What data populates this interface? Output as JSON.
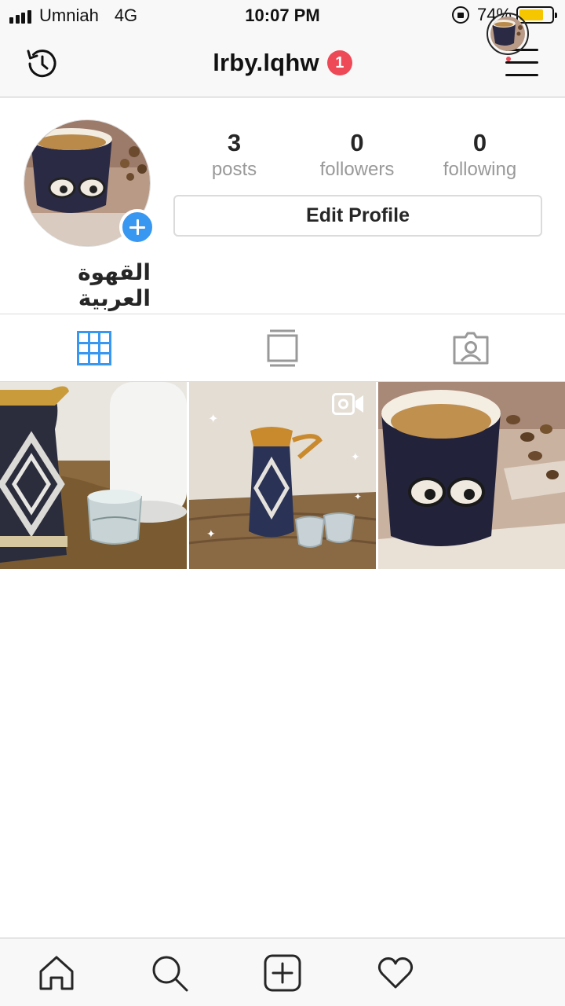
{
  "status_bar": {
    "carrier": "Umniah",
    "network": "4G",
    "time": "10:07 PM",
    "battery_percent": "74%",
    "battery_level": 0.74,
    "battery_color": "#f6c700"
  },
  "header": {
    "username": "lrby.lqhw",
    "notification_count": "1",
    "badge_color": "#ed4956"
  },
  "profile": {
    "display_name": "القهوة العربية",
    "stats": [
      {
        "value": "3",
        "label": "posts"
      },
      {
        "value": "0",
        "label": "followers"
      },
      {
        "value": "0",
        "label": "following"
      }
    ],
    "edit_button_label": "Edit Profile"
  },
  "tabs": [
    {
      "icon": "grid-icon",
      "active": true
    },
    {
      "icon": "feed-icon",
      "active": false
    },
    {
      "icon": "tagged-icon",
      "active": false
    }
  ],
  "posts": [
    {
      "content": "coffee-dallah-and-cups-image",
      "is_video": false
    },
    {
      "content": "dallah-and-cups-on-carpet-image",
      "is_video": true
    },
    {
      "content": "coffee-cup-with-cardamom-image",
      "is_video": false
    }
  ],
  "bottom_nav": [
    {
      "icon": "home-icon"
    },
    {
      "icon": "search-icon"
    },
    {
      "icon": "new-post-icon"
    },
    {
      "icon": "heart-icon"
    },
    {
      "icon": "profile-avatar-icon"
    }
  ],
  "colors": {
    "accent": "#3897f0",
    "text": "#262626",
    "muted": "#999999",
    "border": "#dbdbdb"
  }
}
